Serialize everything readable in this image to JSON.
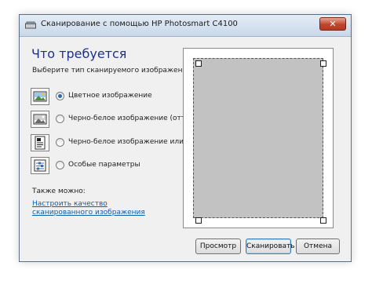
{
  "window": {
    "title": "Сканирование с помощью HP Photosmart C4100",
    "close_glyph": "✕"
  },
  "content": {
    "heading": "Что требуется",
    "subtitle": "Выберите тип сканируемого изображения.",
    "options": [
      {
        "label": "Цветное изображение",
        "checked": true,
        "icon": "color-photo-icon"
      },
      {
        "label": "Черно-белое изображение (оттенки",
        "checked": false,
        "icon": "grayscale-photo-icon"
      },
      {
        "label": "Черно-белое изображение или текс",
        "checked": false,
        "icon": "bw-text-icon"
      },
      {
        "label": "Особые параметры",
        "checked": false,
        "icon": "custom-settings-icon"
      }
    ],
    "also_label": "Также можно:",
    "adjust_link": "Настроить качество сканированного изображения"
  },
  "buttons": {
    "preview": "Просмотр",
    "scan": "Сканировать",
    "cancel": "Отмена"
  },
  "colors": {
    "heading": "#1e3287",
    "link": "#0f5ea8",
    "scan_area": "#c2c2c2",
    "close_button": "#c0452d"
  }
}
